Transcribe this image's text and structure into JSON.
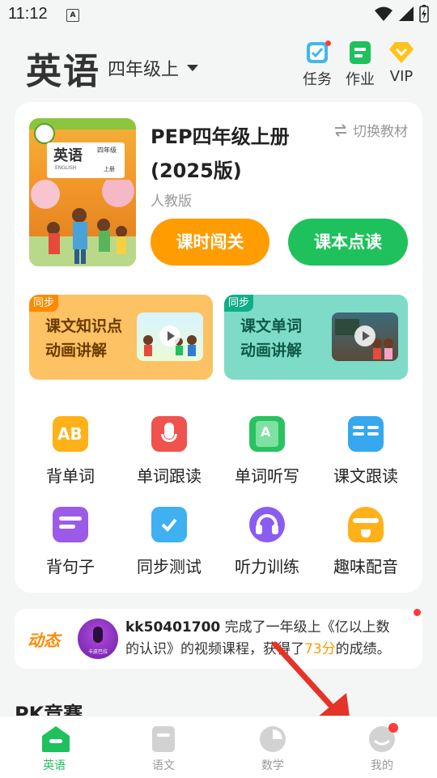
{
  "status": {
    "time": "11:12",
    "badge": "A"
  },
  "header": {
    "subject": "英语",
    "grade": "四年级上",
    "actions": [
      {
        "label": "任务",
        "icon": "task-icon",
        "has_dot": true
      },
      {
        "label": "作业",
        "icon": "homework-icon"
      },
      {
        "label": "VIP",
        "icon": "vip-diamond-icon"
      }
    ]
  },
  "book": {
    "title": "PEP四年级上册(2025版)",
    "publisher": "人教版",
    "switch_label": "切换教材",
    "cover_title": "英语",
    "cover_subtitle": "ENGLISH",
    "cover_grade": "四年级",
    "cover_vol": "上册",
    "btn_lesson": "课时闯关",
    "btn_read": "课本点读"
  },
  "promos": [
    {
      "tag": "同步",
      "line1": "课文知识点",
      "line2": "动画讲解"
    },
    {
      "tag": "同步",
      "line1": "课文单词",
      "line2": "动画讲解"
    }
  ],
  "features": [
    {
      "label": "背单词",
      "icon": "ab-card-icon"
    },
    {
      "label": "单词跟读",
      "icon": "microphone-icon"
    },
    {
      "label": "单词听写",
      "icon": "dictation-pen-icon"
    },
    {
      "label": "课文跟读",
      "icon": "open-book-icon"
    },
    {
      "label": "背句子",
      "icon": "sentence-icon"
    },
    {
      "label": "同步测试",
      "icon": "test-clipboard-icon"
    },
    {
      "label": "听力训练",
      "icon": "headphones-icon"
    },
    {
      "label": "趣味配音",
      "icon": "dubbing-bell-icon"
    }
  ],
  "feed": {
    "label": "动态",
    "avatar_caption": "卡皮巴拉",
    "user": "kk50401700",
    "text_before": " 完成了一年级上《亿以上数的认识》的视频课程，获得了",
    "score": "73分",
    "text_after": "的成绩。"
  },
  "pk": {
    "title": "PK竞赛"
  },
  "tabs": [
    {
      "label": "英语",
      "active": true
    },
    {
      "label": "语文"
    },
    {
      "label": "数学"
    },
    {
      "label": "我的",
      "has_dot": true
    }
  ],
  "colors": {
    "green": "#1ec15c",
    "orange": "#ff9c00",
    "red_dot": "#ff3b3b"
  }
}
